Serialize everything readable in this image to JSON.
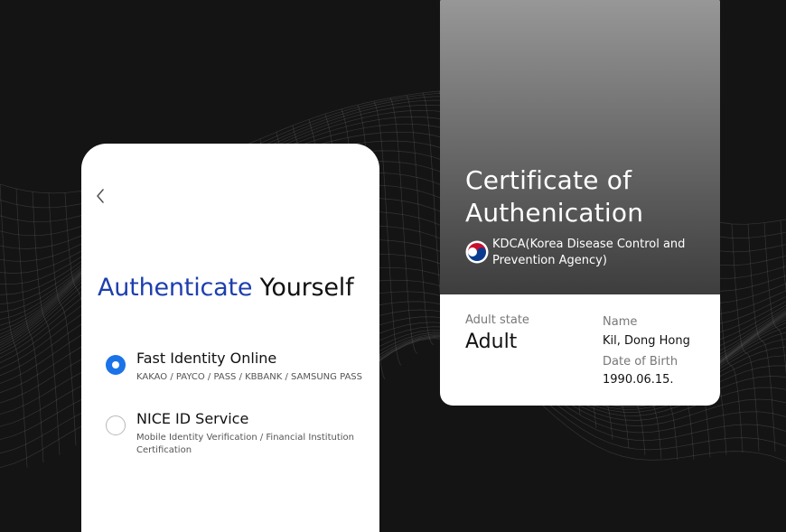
{
  "login": {
    "heading_accent": "Authenticate",
    "heading_rest": "Yourself",
    "options": [
      {
        "title": "Fast Identity Online",
        "subtitle": "KAKAO / PAYCO / PASS / KBBANK / SAMSUNG PASS",
        "selected": true
      },
      {
        "title": "NICE ID Service",
        "subtitle": "Mobile Identity Verification / Financial Institution Certification",
        "selected": false
      }
    ]
  },
  "certificate": {
    "title": "Certificate of Authenication",
    "agency": "KDCA(Korea Disease Control and Prevention Agency)",
    "adult_state_label": "Adult state",
    "adult_state_value": "Adult",
    "name_label": "Name",
    "name_value": "Kil, Dong Hong",
    "dob_label": "Date of Birth",
    "dob_value": "1990.06.15."
  },
  "colors": {
    "accent_blue": "#1d3fae",
    "radio_selected": "#1a73e8",
    "background": "#141414"
  },
  "icons": {
    "back": "chevron-left-icon",
    "emblem": "korea-taegeuk-emblem"
  }
}
